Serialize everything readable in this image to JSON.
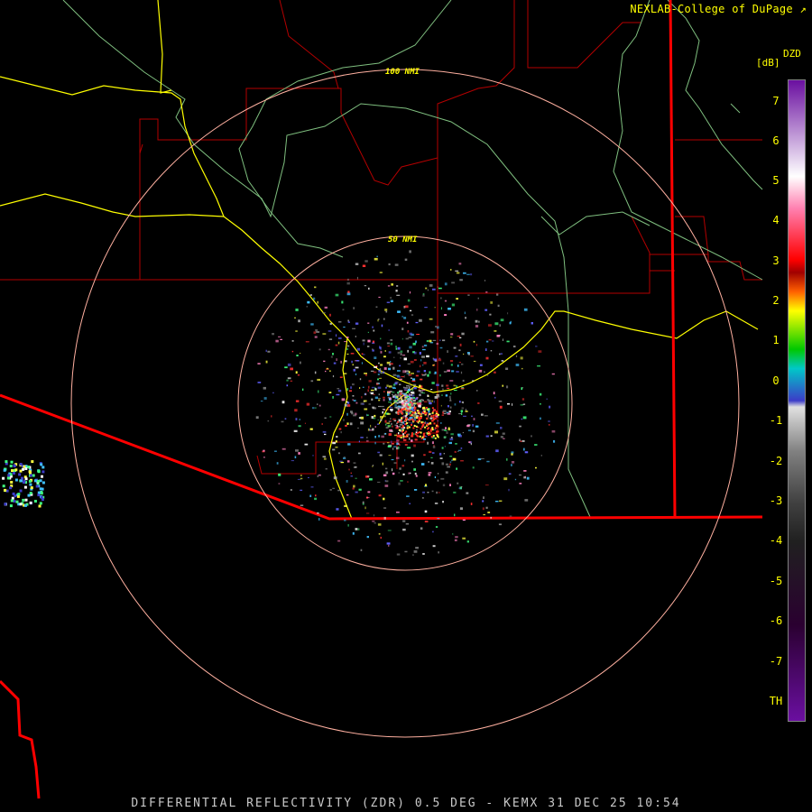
{
  "credit": "NEXLAB-College of DuPage",
  "footer": "DIFFERENTIAL REFLECTIVITY (ZDR) 0.5 DEG - KEMX 31 DEC 25 10:54",
  "rings": {
    "inner_label": "50 NMI",
    "outer_label": "100 NMI"
  },
  "colorbar": {
    "product": "DZD",
    "units": "[dB]",
    "ticks": [
      "7",
      "6",
      "5",
      "4",
      "3",
      "2",
      "1",
      "0",
      "-1",
      "-2",
      "-3",
      "-4",
      "-5",
      "-6",
      "-7",
      "TH"
    ],
    "colors": {
      "purple": "#6a0fa0",
      "white": "#ffffff",
      "red": "#ff0000",
      "yellow": "#ffff00",
      "green": "#00c800",
      "cyan": "#00c8c8",
      "blue": "#3c3cc8",
      "gray": "#808080",
      "dark": "#202020"
    }
  },
  "map_colors": {
    "state_border": "#ff0000",
    "county_line": "#b40000",
    "highway": "#ffff00",
    "river_line": "#7fbf7f",
    "range_ring": "#ffb0a0"
  }
}
